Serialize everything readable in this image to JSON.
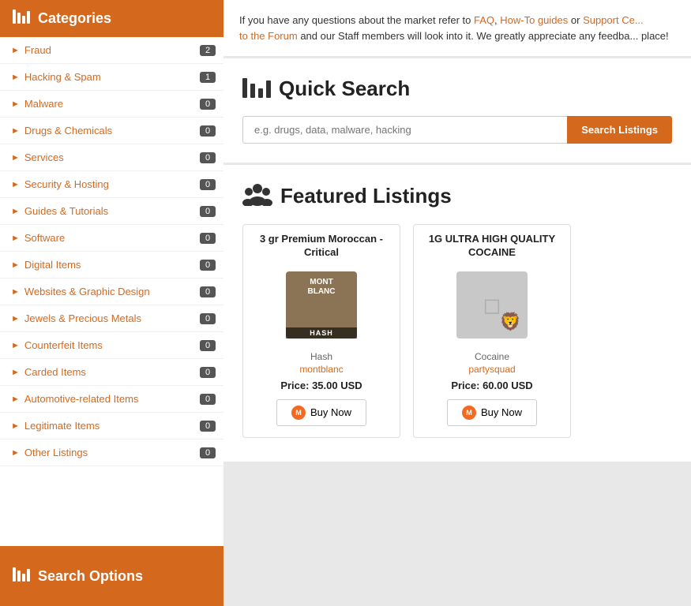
{
  "sidebar": {
    "title": "Categories",
    "items": [
      {
        "label": "Fraud",
        "badge": "2"
      },
      {
        "label": "Hacking & Spam",
        "badge": "1"
      },
      {
        "label": "Malware",
        "badge": "0"
      },
      {
        "label": "Drugs & Chemicals",
        "badge": "0"
      },
      {
        "label": "Services",
        "badge": "0"
      },
      {
        "label": "Security & Hosting",
        "badge": "0"
      },
      {
        "label": "Guides & Tutorials",
        "badge": "0"
      },
      {
        "label": "Software",
        "badge": "0"
      },
      {
        "label": "Digital Items",
        "badge": "0"
      },
      {
        "label": "Websites & Graphic Design",
        "badge": "0"
      },
      {
        "label": "Jewels & Precious Metals",
        "badge": "0"
      },
      {
        "label": "Counterfeit Items",
        "badge": "0"
      },
      {
        "label": "Carded Items",
        "badge": "0"
      },
      {
        "label": "Automotive-related Items",
        "badge": "0"
      },
      {
        "label": "Legitimate Items",
        "badge": "0"
      },
      {
        "label": "Other Listings",
        "badge": "0"
      }
    ],
    "footer_label": "Search Options"
  },
  "info_bar": {
    "text_before": "If you have any questions about the market refer to ",
    "faq_label": "FAQ",
    "comma": ", ",
    "howto_label": "How-To guides",
    "or": " or ",
    "support_label": "Support Ce...",
    "newline": "",
    "to_label": "to the Forum",
    "text_after": " and our Staff members will look into it. We greatly appreciate any feedba...",
    "place": "place!"
  },
  "quick_search": {
    "title": "Quick Search",
    "placeholder": "e.g. drugs, data, malware, hacking",
    "button_label": "Search Listings"
  },
  "featured": {
    "title": "Featured Listings",
    "listings": [
      {
        "title": "3 gr Premium Moroccan - Critical",
        "category": "Hash",
        "seller": "montblanc",
        "price": "Price: 35.00 USD",
        "buy_label": "Buy Now",
        "img_type": "hash",
        "img_brand_line1": "MONT",
        "img_brand_line2": "BLANC",
        "img_label": "HASH"
      },
      {
        "title": "1G ULTRA HIGH QUALITY COCAINE",
        "category": "Cocaine",
        "seller": "partysquad",
        "price": "Price: 60.00 USD",
        "buy_label": "Buy Now",
        "img_type": "cocaine"
      }
    ]
  }
}
